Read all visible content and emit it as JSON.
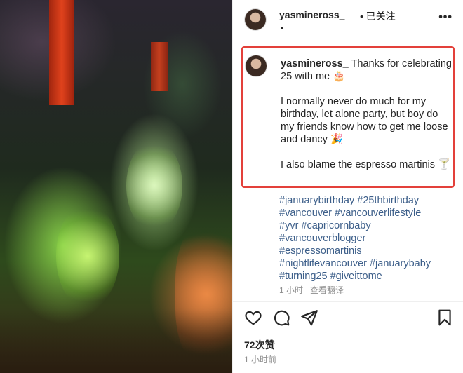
{
  "post": {
    "username": "yasmineross_",
    "separator": "•",
    "follow_status": "已关注",
    "subline": "•",
    "more": "•••"
  },
  "caption": {
    "username": "yasmineross_",
    "line1": " Thanks for celebrating 25 with me 🎂",
    "paragraph2": "I normally never do much for my birthday, let alone party, but boy do my friends know how to get me loose and dancy 🎉",
    "paragraph3": "I also blame the espresso martinis 🍸"
  },
  "hashtags": [
    "#januarybirthday",
    "#25thbirthday",
    "#vancouver",
    "#vancouverlifestyle",
    "#yvr",
    "#capricornbaby",
    "#vancouverblogger",
    "#espressomartinis",
    "#nightlifevancouver",
    "#januarybaby",
    "#turning25",
    "#giveittome"
  ],
  "caption_meta": {
    "time": "1 小时",
    "translate": "查看翻译"
  },
  "actions": {
    "like": "heart-icon",
    "comment": "comment-icon",
    "share": "send-icon",
    "save": "bookmark-icon"
  },
  "likes": "72次赞",
  "posted_time": "1 小时前",
  "colors": {
    "highlight_border": "#e3403a",
    "hashtag": "#3d5f8a",
    "muted": "#8e8e8e"
  }
}
